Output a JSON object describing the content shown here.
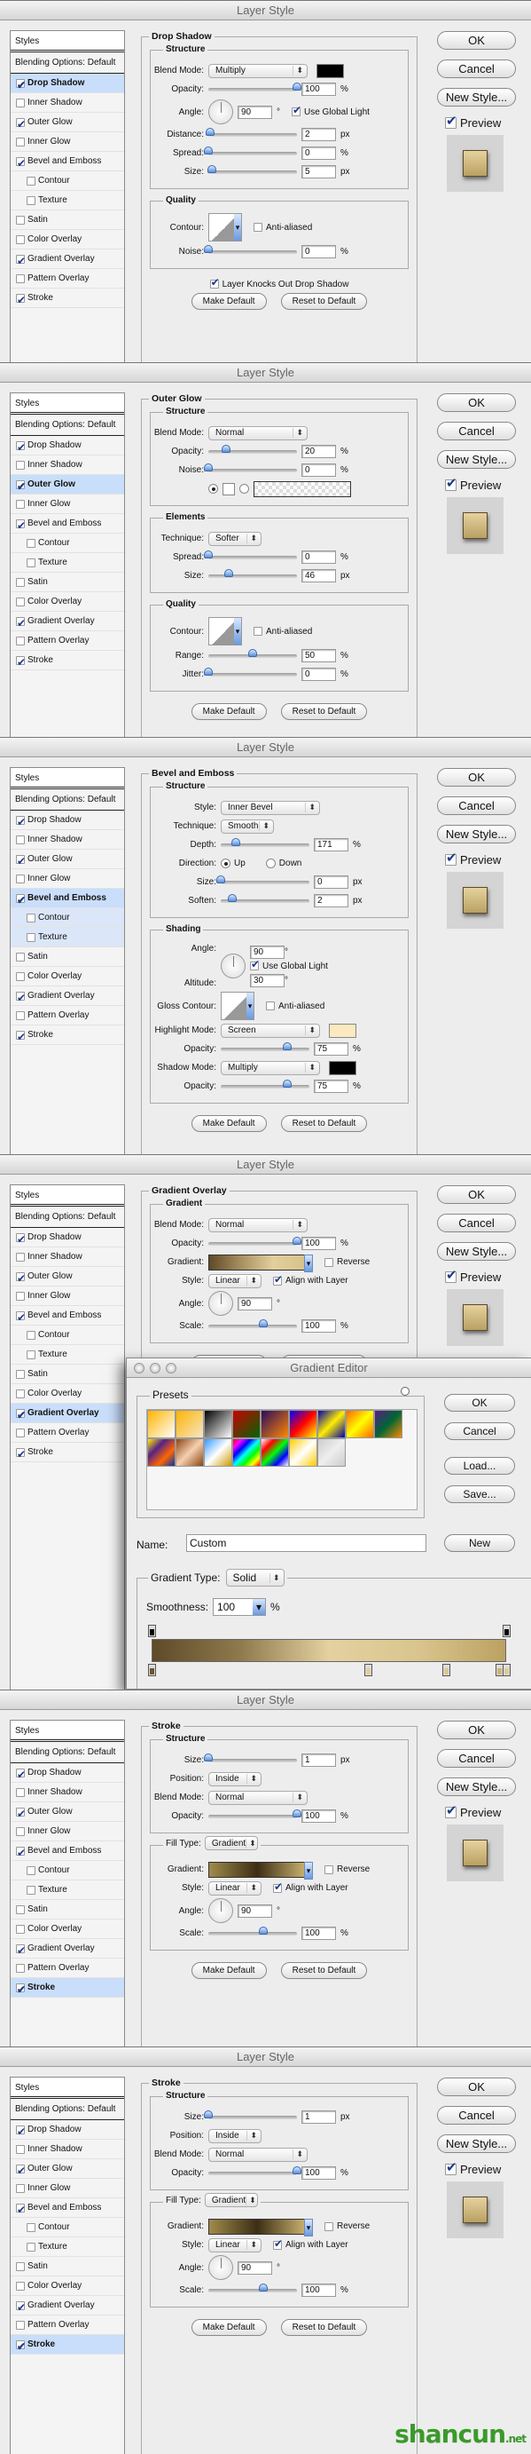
{
  "window_title": "Layer Style",
  "sidebar": {
    "styles_label": "Styles",
    "blending_label": "Blending Options: Default",
    "items": [
      {
        "label": "Drop Shadow",
        "checked": true
      },
      {
        "label": "Inner Shadow",
        "checked": false
      },
      {
        "label": "Outer Glow",
        "checked": true
      },
      {
        "label": "Inner Glow",
        "checked": false
      },
      {
        "label": "Bevel and Emboss",
        "checked": true
      },
      {
        "label": "Contour",
        "checked": false,
        "sub": true
      },
      {
        "label": "Texture",
        "checked": false,
        "sub": true
      },
      {
        "label": "Satin",
        "checked": false
      },
      {
        "label": "Color Overlay",
        "checked": false
      },
      {
        "label": "Gradient Overlay",
        "checked": true
      },
      {
        "label": "Pattern Overlay",
        "checked": false
      },
      {
        "label": "Stroke",
        "checked": true
      }
    ]
  },
  "buttons": {
    "ok": "OK",
    "cancel": "Cancel",
    "new_style": "New Style...",
    "preview": "Preview",
    "preview_checked": true,
    "make_default": "Make Default",
    "reset_default": "Reset to Default"
  },
  "colors": {
    "selection": "#c9defa",
    "preview_swatch": "#d8c38e"
  },
  "panels": [
    {
      "title": "Drop Shadow",
      "active": 0,
      "groups": [
        {
          "legend": "Structure",
          "rows": [
            {
              "type": "select",
              "label": "Blend Mode:",
              "value": "Multiply",
              "color": "#000000"
            },
            {
              "type": "slider",
              "label": "Opacity:",
              "value": "100",
              "unit": "%",
              "level": 1.0
            },
            {
              "type": "angle",
              "label": "Angle:",
              "value": "90",
              "unit": "°",
              "check": {
                "label": "Use Global Light",
                "checked": true
              }
            },
            {
              "type": "slider",
              "label": "Distance:",
              "value": "2",
              "unit": "px",
              "level": 0.02
            },
            {
              "type": "slider",
              "label": "Spread:",
              "value": "0",
              "unit": "%",
              "level": 0
            },
            {
              "type": "slider",
              "label": "Size:",
              "value": "5",
              "unit": "px",
              "level": 0.04
            }
          ]
        },
        {
          "legend": "Quality",
          "rows": [
            {
              "type": "contour",
              "label": "Contour:",
              "check": {
                "label": "Anti-aliased",
                "checked": false
              }
            },
            {
              "type": "slider",
              "label": "Noise:",
              "value": "0",
              "unit": "%",
              "level": 0
            }
          ]
        }
      ],
      "footer_check": {
        "label": "Layer Knocks Out Drop Shadow",
        "checked": true
      }
    },
    {
      "title": "Outer Glow",
      "active": 2,
      "groups": [
        {
          "legend": "Structure",
          "rows": [
            {
              "type": "select",
              "label": "Blend Mode:",
              "value": "Normal"
            },
            {
              "type": "slider",
              "label": "Opacity:",
              "value": "20",
              "unit": "%",
              "level": 0.2
            },
            {
              "type": "slider",
              "label": "Noise:",
              "value": "0",
              "unit": "%",
              "level": 0
            },
            {
              "type": "glowsource",
              "solid_selected": true,
              "color": "#ffffff"
            }
          ]
        },
        {
          "legend": "Elements",
          "rows": [
            {
              "type": "select",
              "size": "s",
              "label": "Technique:",
              "value": "Softer"
            },
            {
              "type": "slider",
              "label": "Spread:",
              "value": "0",
              "unit": "%",
              "level": 0
            },
            {
              "type": "slider",
              "label": "Size:",
              "value": "46",
              "unit": "px",
              "level": 0.23
            }
          ]
        },
        {
          "legend": "Quality",
          "rows": [
            {
              "type": "contour",
              "label": "Contour:",
              "check": {
                "label": "Anti-aliased",
                "checked": false
              }
            },
            {
              "type": "slider",
              "label": "Range:",
              "value": "50",
              "unit": "%",
              "level": 0.5
            },
            {
              "type": "slider",
              "label": "Jitter:",
              "value": "0",
              "unit": "%",
              "level": 0
            }
          ]
        }
      ]
    },
    {
      "title": "Bevel and Emboss",
      "active": 4,
      "active_sub": [
        5,
        6
      ],
      "groups": [
        {
          "legend": "Structure",
          "rows": [
            {
              "type": "select",
              "size": "l",
              "label": "Style:",
              "value": "Inner Bevel"
            },
            {
              "type": "select",
              "size": "s",
              "label": "Technique:",
              "value": "Smooth"
            },
            {
              "type": "slider",
              "label": "Depth:",
              "value": "171",
              "unit": "%",
              "level": 0.17
            },
            {
              "type": "radio",
              "label": "Direction:",
              "options": [
                {
                  "label": "Up",
                  "checked": true
                },
                {
                  "label": "Down",
                  "checked": false
                }
              ]
            },
            {
              "type": "slider",
              "label": "Size:",
              "value": "0",
              "unit": "px",
              "level": 0
            },
            {
              "type": "slider",
              "label": "Soften:",
              "value": "2",
              "unit": "px",
              "level": 0.13
            }
          ]
        },
        {
          "legend": "Shading",
          "rows": [
            {
              "type": "anglealt",
              "label": "Angle:",
              "label2": "Altitude:",
              "value": "90",
              "value2": "30",
              "unit": "°",
              "check": {
                "label": "Use Global Light",
                "checked": true
              }
            },
            {
              "type": "contour",
              "label": "Gloss Contour:",
              "check": {
                "label": "Anti-aliased",
                "checked": false
              }
            },
            {
              "type": "select",
              "label": "Highlight Mode:",
              "value": "Screen",
              "color": "#fde9bf"
            },
            {
              "type": "slider",
              "label": "Opacity:",
              "value": "75",
              "unit": "%",
              "level": 0.75
            },
            {
              "type": "select",
              "label": "Shadow Mode:",
              "value": "Multiply",
              "color": "#000000"
            },
            {
              "type": "slider",
              "label": "Opacity:",
              "value": "75",
              "unit": "%",
              "level": 0.75
            }
          ]
        }
      ]
    },
    {
      "title": "Gradient Overlay",
      "active": 9,
      "groups": [
        {
          "legend": "Gradient",
          "rows": [
            {
              "type": "select",
              "label": "Blend Mode:",
              "value": "Normal"
            },
            {
              "type": "slider",
              "label": "Opacity:",
              "value": "100",
              "unit": "%",
              "level": 1.0
            },
            {
              "type": "gradient",
              "label": "Gradient:",
              "colors": [
                "#5e4a28",
                "#a89060",
                "#e2cf9c",
                "#d6c28a"
              ],
              "check": {
                "label": "Reverse",
                "checked": false
              }
            },
            {
              "type": "select",
              "size": "s",
              "label": "Style:",
              "value": "Linear",
              "check": {
                "label": "Align with Layer",
                "checked": true
              }
            },
            {
              "type": "angle",
              "label": "Angle:",
              "value": "90",
              "unit": "°"
            },
            {
              "type": "slider",
              "label": "Scale:",
              "value": "100",
              "unit": "%",
              "level": 0.62
            }
          ]
        }
      ],
      "gradient_editor": {
        "title": "Gradient Editor",
        "presets_label": "Presets",
        "presets": [
          [
            "#ffb400",
            "#ffffff"
          ],
          [
            "#ffb400",
            "#f4e6c8"
          ],
          [
            "#000000",
            "#ffffff"
          ],
          [
            "#cc0000",
            "#006600"
          ],
          [
            "#2a0a5e",
            "#ff8800"
          ],
          [
            "#0000ff",
            "#ff0000",
            "#ffff00"
          ],
          [
            "#0000aa",
            "#ffee00",
            "#0000aa"
          ],
          [
            "#ff6600",
            "#ffff00",
            "#ff6600"
          ],
          [
            "#5a1a8a",
            "#006633",
            "#ff8800"
          ],
          [
            "#ffee00",
            "#552288",
            "#ff6600",
            "#0033aa"
          ],
          [
            "#8b4513",
            "#f5d0b0",
            "#8b4513"
          ],
          [
            "#3399ff",
            "#ffffff",
            "#cc9900"
          ],
          [
            "#ff0000",
            "#ff00ff",
            "#0000ff",
            "#00ffff",
            "#00ff00",
            "#ffff00",
            "#ff0000"
          ],
          [
            "#ffffff",
            "#ff0000",
            "#00ff00",
            "#0000ff",
            "#ffffff"
          ],
          [
            "#ffcc00",
            "#ffffff",
            "#ffcc00"
          ],
          [
            "#cccccc",
            "#eeeeee",
            "#cccccc"
          ]
        ],
        "buttons": {
          "ok": "OK",
          "cancel": "Cancel",
          "load": "Load...",
          "save": "Save...",
          "new": "New"
        },
        "name_label": "Name:",
        "name_value": "Custom",
        "type_label": "Gradient Type:",
        "type_value": "Solid",
        "smoothness_label": "Smoothness:",
        "smoothness_value": "100",
        "smoothness_unit": "%",
        "bar_colors": [
          "#5e4a28",
          "#8f7a4e",
          "#e4d1a0",
          "#d9c58e",
          "#bba262"
        ],
        "color_stops": [
          {
            "pos": 0,
            "color": "#6b5530"
          },
          {
            "pos": 61,
            "color": "#e2cf9c"
          },
          {
            "pos": 83,
            "color": "#dcc893"
          },
          {
            "pos": 98,
            "color": "#cbb57a"
          },
          {
            "pos": 100,
            "color": "#e0cc98"
          }
        ],
        "opacity_stops": [
          0,
          100
        ]
      }
    },
    {
      "title": "Stroke",
      "active": 11,
      "groups": [
        {
          "legend": "Structure",
          "rows": [
            {
              "type": "slider",
              "label": "Size:",
              "value": "1",
              "unit": "px",
              "level": 0
            },
            {
              "type": "select",
              "size": "s",
              "label": "Position:",
              "value": "Inside"
            },
            {
              "type": "select",
              "label": "Blend Mode:",
              "value": "Normal"
            },
            {
              "type": "slider",
              "label": "Opacity:",
              "value": "100",
              "unit": "%",
              "level": 1.0
            }
          ]
        },
        {
          "legend": "Fill Type:",
          "legend_select": "Gradient",
          "rows": [
            {
              "type": "gradient",
              "label": "Gradient:",
              "colors": [
                "#a08a4c",
                "#3c2e14",
                "#c8b070"
              ],
              "check": {
                "label": "Reverse",
                "checked": false
              }
            },
            {
              "type": "select",
              "size": "s",
              "label": "Style:",
              "value": "Linear",
              "check": {
                "label": "Align with Layer",
                "checked": true
              }
            },
            {
              "type": "angle",
              "label": "Angle:",
              "value": "90",
              "unit": "°"
            },
            {
              "type": "slider",
              "label": "Scale:",
              "value": "100",
              "unit": "%",
              "level": 0.62
            }
          ]
        }
      ]
    },
    {
      "title": "Stroke",
      "active": 11,
      "groups": [
        {
          "legend": "Structure",
          "rows": [
            {
              "type": "slider",
              "label": "Size:",
              "value": "1",
              "unit": "px",
              "level": 0
            },
            {
              "type": "select",
              "size": "s",
              "label": "Position:",
              "value": "Inside"
            },
            {
              "type": "select",
              "label": "Blend Mode:",
              "value": "Normal"
            },
            {
              "type": "slider",
              "label": "Opacity:",
              "value": "100",
              "unit": "%",
              "level": 1.0
            }
          ]
        },
        {
          "legend": "Fill Type:",
          "legend_select": "Gradient",
          "rows": [
            {
              "type": "gradient",
              "label": "Gradient:",
              "colors": [
                "#a08a4c",
                "#3c2e14",
                "#c8b070"
              ],
              "check": {
                "label": "Reverse",
                "checked": false
              }
            },
            {
              "type": "select",
              "size": "s",
              "label": "Style:",
              "value": "Linear",
              "check": {
                "label": "Align with Layer",
                "checked": true
              }
            },
            {
              "type": "angle",
              "label": "Angle:",
              "value": "90",
              "unit": "°"
            },
            {
              "type": "slider",
              "label": "Scale:",
              "value": "100",
              "unit": "%",
              "level": 0.62
            }
          ]
        }
      ],
      "watermark": {
        "main": "shancun",
        "suffix": ".net"
      }
    }
  ]
}
